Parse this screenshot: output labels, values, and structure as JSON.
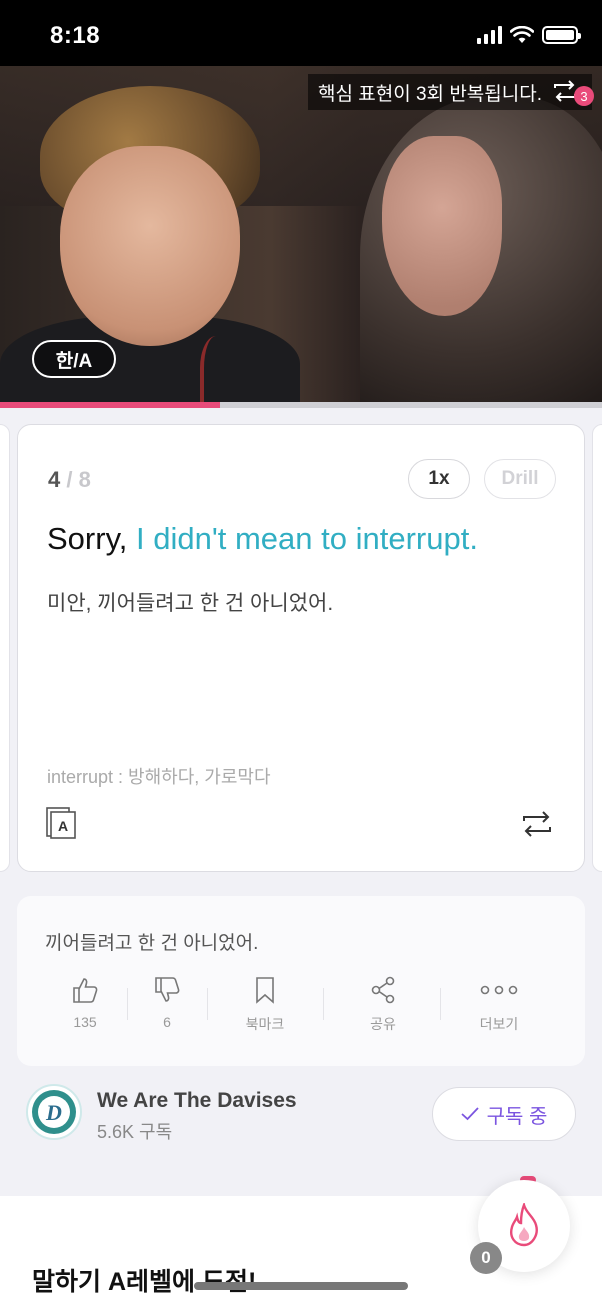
{
  "status_bar": {
    "time": "8:18"
  },
  "video": {
    "repeat_banner": "핵심 표현이 3회 반복됩니다.",
    "repeat_count": "3",
    "lang_toggle": "한/A",
    "progress_fraction": 0.365
  },
  "card": {
    "current": "4",
    "separator": "/",
    "total": "8",
    "speed_label": "1x",
    "drill_label": "Drill",
    "sentence_plain": "Sorry, ",
    "sentence_highlight": "I didn't mean to interrupt.",
    "translation": "미안, 끼어들려고 한 건 아니었어.",
    "vocab": "interrupt : 방해하다, 가로막다",
    "dict_icon_letter": "A",
    "highlight_color": "#31aec3"
  },
  "info": {
    "text": "끼어들려고 한 건 아니었어.",
    "actions": [
      {
        "icon": "thumbs-up-icon",
        "label": "135"
      },
      {
        "icon": "thumbs-down-icon",
        "label": "6"
      },
      {
        "icon": "bookmark-icon",
        "label": "북마크"
      },
      {
        "icon": "share-icon",
        "label": "공유"
      },
      {
        "icon": "more-icon",
        "label": "더보기"
      }
    ]
  },
  "channel": {
    "name": "We Are The Davises",
    "subscribers": "5.6K 구독",
    "subscribe_label": "구독 중",
    "logo_letter": "D"
  },
  "bottom": {
    "title": "말하기 A레벨에 도전!",
    "streak_count": "0"
  },
  "colors": {
    "accent_pink": "#e94b7a",
    "subscribe_purple": "#7b55e0"
  }
}
